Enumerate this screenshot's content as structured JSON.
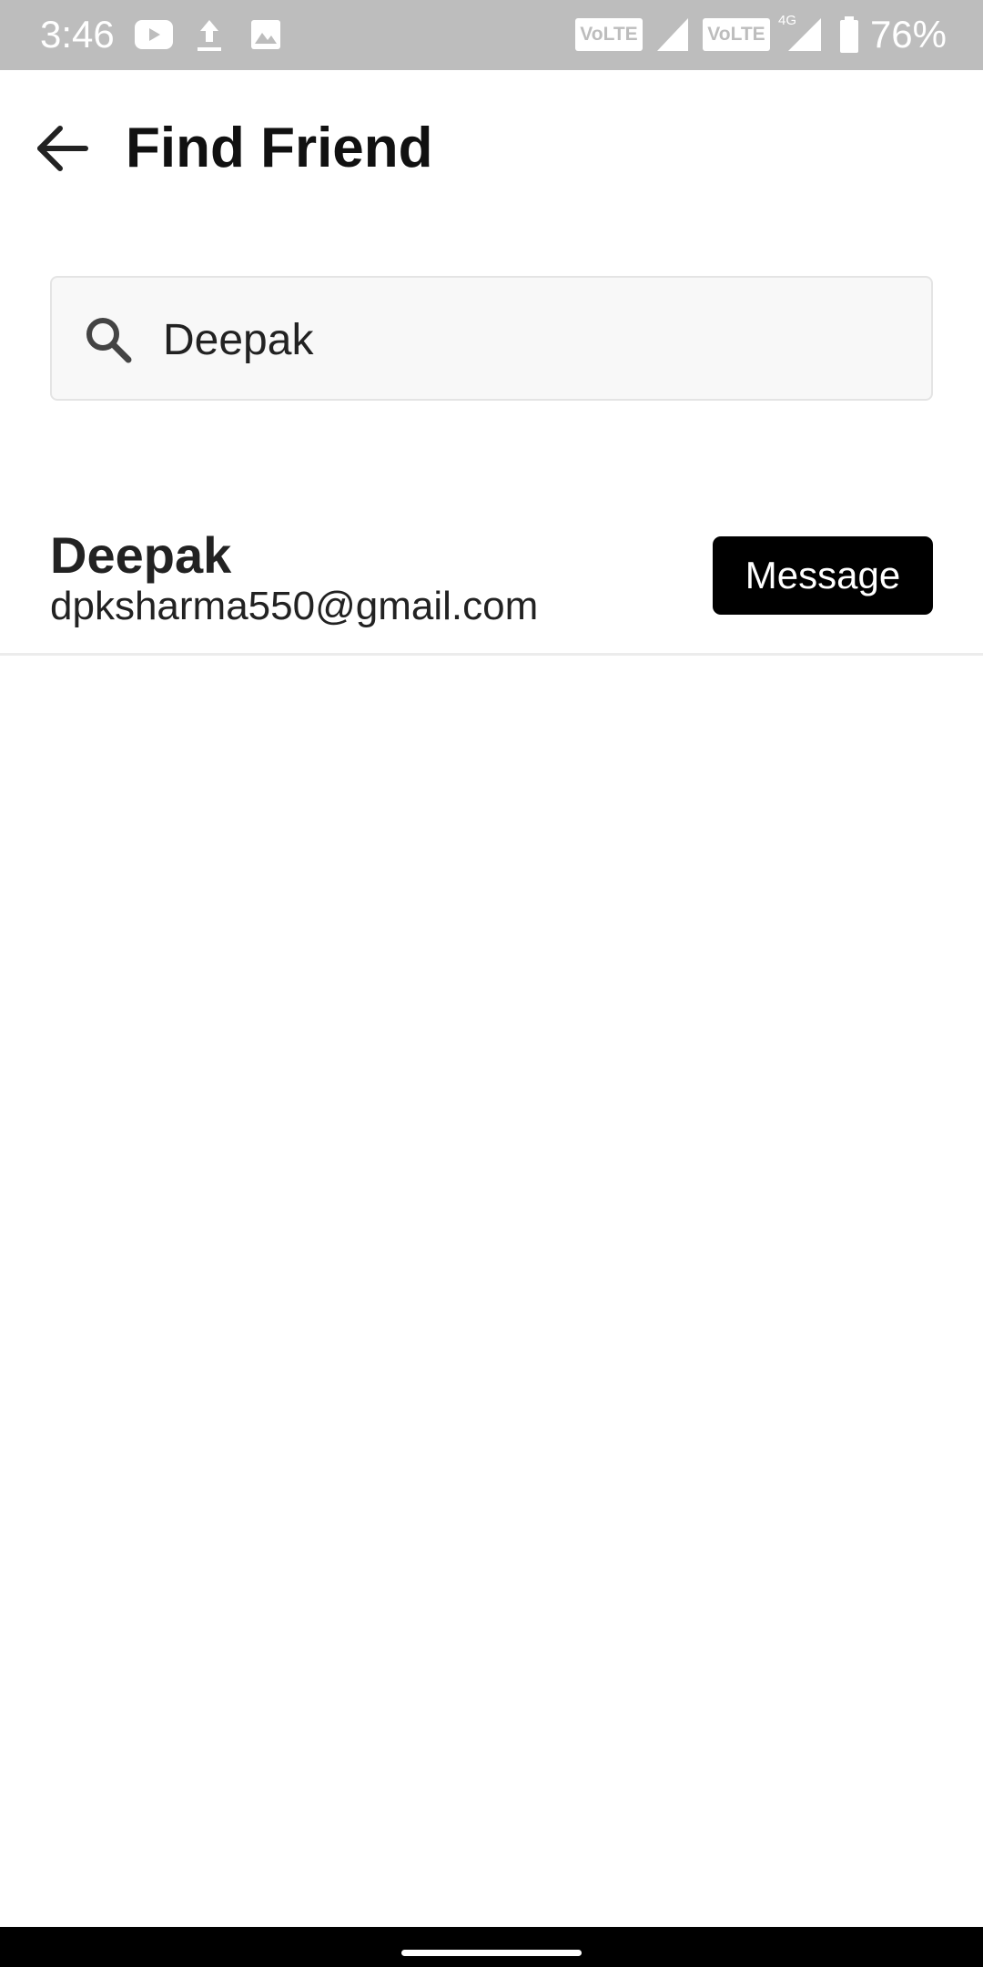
{
  "status_bar": {
    "time": "3:46",
    "icons": [
      "youtube-icon",
      "upload-icon",
      "image-icon",
      "volte-icon",
      "signal-icon",
      "volte-icon",
      "signal-4g-icon",
      "battery-icon"
    ],
    "volte_label": "VoLTE",
    "network_label": "4G",
    "battery": "76%"
  },
  "app_bar": {
    "title": "Find Friend",
    "back_icon": "arrow-back-icon"
  },
  "search": {
    "icon": "search-icon",
    "value": "Deepak"
  },
  "results": [
    {
      "name": "Deepak",
      "email": "dpksharma550@gmail.com",
      "action_label": "Message"
    }
  ],
  "colors": {
    "status_bar_bg": "#bdbdbd",
    "button_bg": "#000000",
    "button_text": "#ffffff",
    "search_bg": "#f8f8f8",
    "divider": "#ececec"
  }
}
